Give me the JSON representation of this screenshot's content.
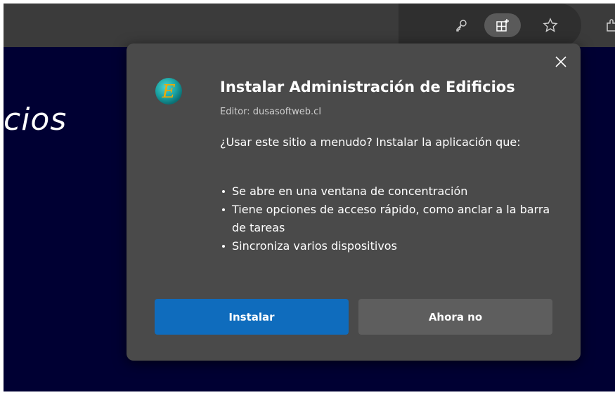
{
  "browser": {
    "icons": [
      "key-icon",
      "app-install-icon",
      "favorite-star-icon",
      "extensions-icon"
    ]
  },
  "page": {
    "partial_heading": "cios"
  },
  "dialog": {
    "title": "Instalar Administración de Edificios",
    "publisher": "Editor: dusasoftweb.cl",
    "prompt": "¿Usar este sitio a menudo? Instalar la aplicación que:",
    "features": [
      "Se abre en una ventana de concentración",
      "Tiene opciones de acceso rápido, como anclar a la barra de tareas",
      "Sincroniza varios dispositivos"
    ],
    "install_label": "Instalar",
    "dismiss_label": "Ahora no",
    "logo_letter": "E",
    "colors": {
      "primary_button": "#0f6cbd",
      "secondary_button": "#5e5e5e",
      "dialog_bg": "#4a4a4a",
      "page_bg": "#000033",
      "logo_teal": "#1aa3a3",
      "logo_letter": "#f2a900"
    }
  }
}
